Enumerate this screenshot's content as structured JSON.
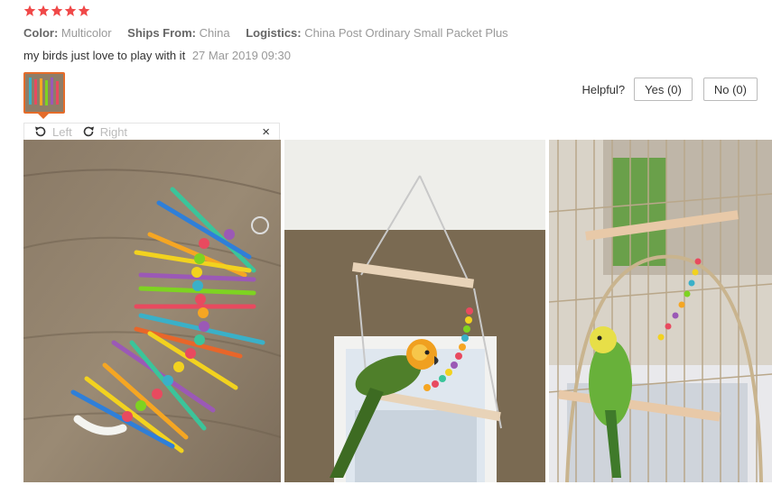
{
  "rating": {
    "stars": 5,
    "color": "#f04848"
  },
  "attributes": [
    {
      "label": "Color:",
      "value": "Multicolor"
    },
    {
      "label": "Ships From:",
      "value": "China"
    },
    {
      "label": "Logistics:",
      "value": "China Post Ordinary Small Packet Plus"
    }
  ],
  "review": {
    "text": "my birds just love to play with it",
    "date": "27 Mar 2019 09:30"
  },
  "helpful": {
    "label": "Helpful?",
    "yes": "Yes (0)",
    "no": "No (0)"
  },
  "viewer": {
    "rotate_left": "Left",
    "rotate_right": "Right",
    "close": "×",
    "icons": [
      "rotate-left-icon",
      "rotate-right-icon",
      "close-icon"
    ]
  },
  "photos": [
    {
      "subject": "colorful-bird-toy-on-wood-table"
    },
    {
      "subject": "parrot-on-hanging-swing"
    },
    {
      "subject": "budgie-in-cage"
    }
  ],
  "colors": {
    "accent": "#e56c2a",
    "star": "#f04848"
  }
}
